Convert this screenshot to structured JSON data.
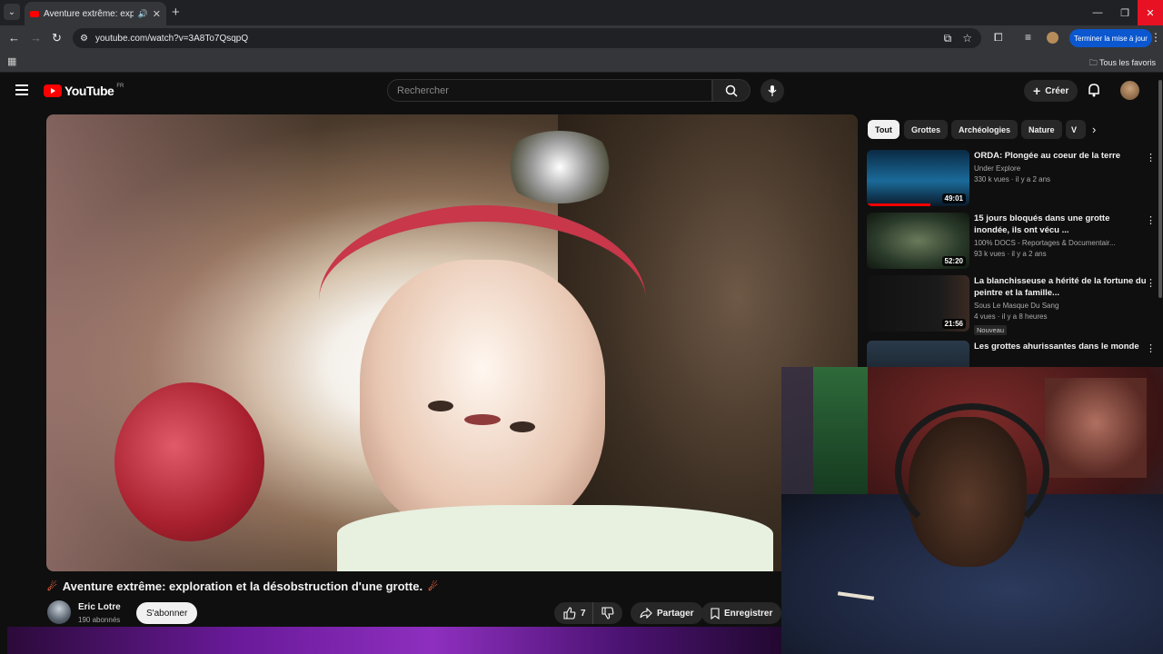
{
  "browser": {
    "tab_title": "Aventure extrême: expl",
    "url": "youtube.com/watch?v=3A8To7QsqpQ",
    "update_button": "Terminer la mise à jour",
    "bookmarks_label": "Tous les favoris"
  },
  "youtube": {
    "logo_text": "YouTube",
    "region": "FR",
    "search_placeholder": "Rechercher",
    "create_label": "Créer"
  },
  "video": {
    "title": "Aventure extrême: exploration et la désobstruction d'une grotte.",
    "channel": "Eric Lotre",
    "subscribers": "190 abonnés",
    "subscribe_label": "S'abonner",
    "likes": "7",
    "share_label": "Partager",
    "save_label": "Enregistrer"
  },
  "chips": [
    "Tout",
    "Grottes",
    "Archéologies",
    "Nature",
    "V"
  ],
  "recommended": [
    {
      "title": "ORDA: Plongée au coeur de la terre",
      "channel": "Under Explore",
      "meta": "330 k vues · il y a 2 ans",
      "duration": "49:01",
      "badge": "",
      "progress": 0.62
    },
    {
      "title": "15 jours bloqués dans une grotte inondée, ils ont vécu ...",
      "channel": "100% DOCS - Reportages & Documentair...",
      "meta": "93 k vues · il y a 2 ans",
      "duration": "52:20",
      "badge": "",
      "progress": 0
    },
    {
      "title": "La blanchisseuse a hérité de la fortune du peintre et la famille...",
      "channel": "Sous Le Masque Du Sang",
      "meta": "4 vues · il y a 8 heures",
      "duration": "21:56",
      "badge": "Nouveau",
      "progress": 0
    },
    {
      "title": "Les grottes ahurissantes dans le monde",
      "channel": "",
      "meta": "",
      "duration": "",
      "badge": "",
      "progress": 0
    }
  ],
  "icons": {
    "like": "thumbs-up-icon",
    "dislike": "thumbs-down-icon",
    "share": "share-arrow-icon",
    "save": "bookmark-icon",
    "search": "search-icon",
    "mic": "microphone-icon",
    "bell": "bell-icon"
  },
  "colors": {
    "brand_red": "#ff0000",
    "update_blue": "#0b57d0",
    "bg": "#0f0f0f"
  }
}
